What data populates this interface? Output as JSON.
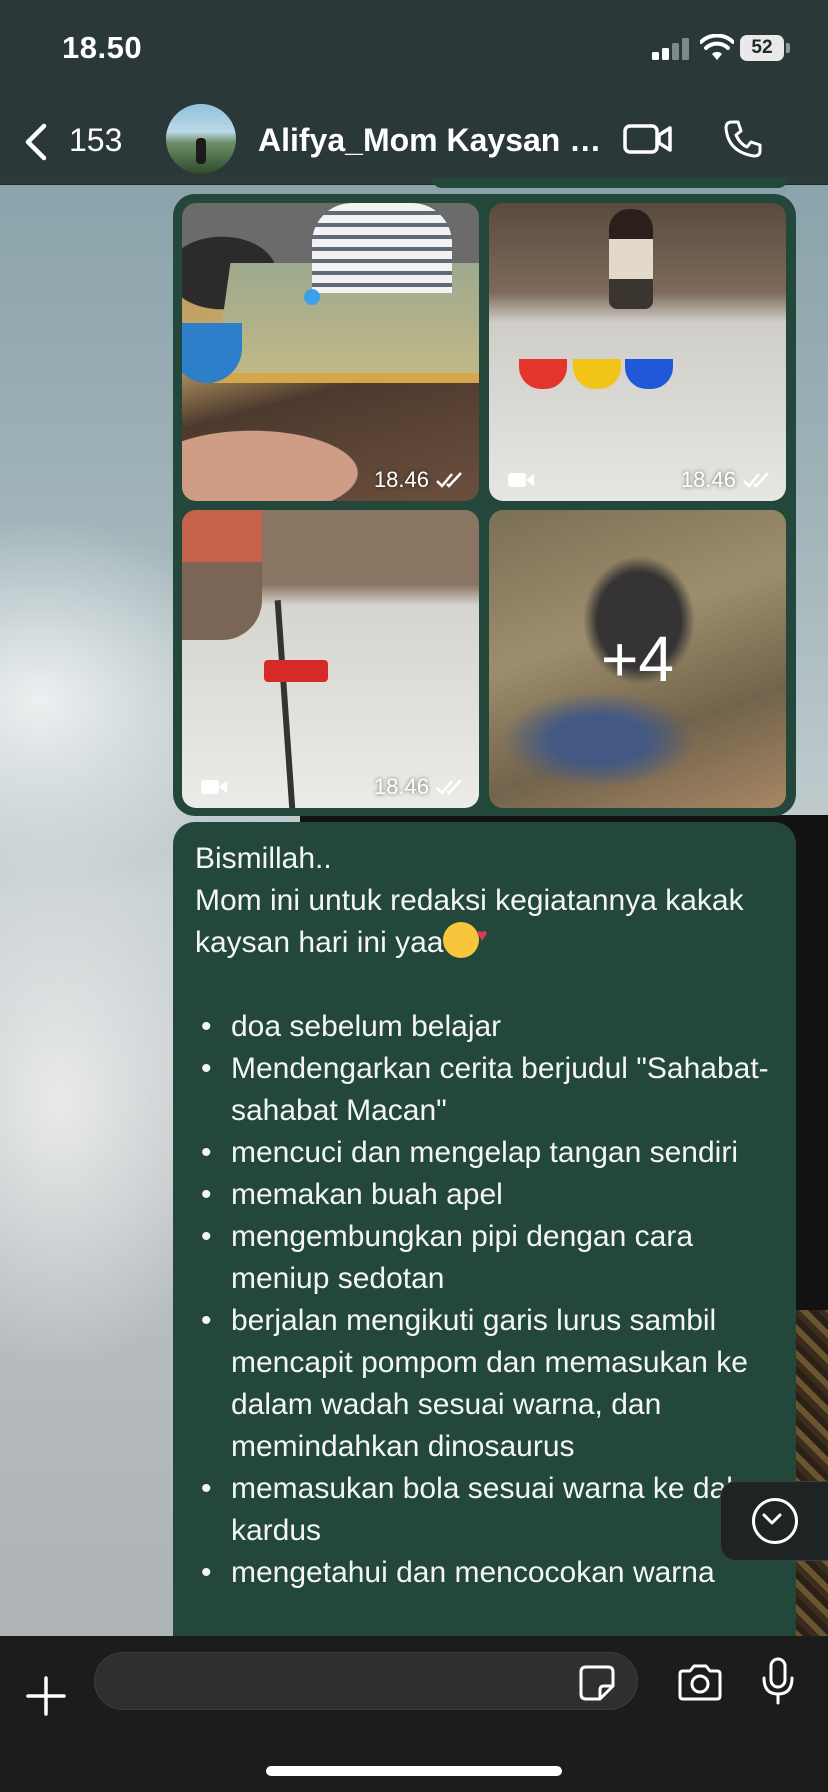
{
  "status_bar": {
    "time": "18.50",
    "battery": "52"
  },
  "header": {
    "back_count": "153",
    "title": "Alifya_Mom Kaysan (…"
  },
  "album": {
    "photos": [
      {
        "time": "18.46",
        "type": "photo"
      },
      {
        "time": "18.46",
        "type": "video"
      },
      {
        "time": "18.46",
        "type": "video"
      },
      {
        "more": "+4"
      }
    ]
  },
  "message": {
    "greeting": "Bismillah..",
    "intro": "Mom ini untuk redaksi kegiatannya kakak kaysan hari ini yaa",
    "intro_emoji": "smiling-face-with-hearts",
    "items": [
      "doa sebelum belajar",
      "Mendengarkan cerita berjudul \"Sahabat-sahabat Macan\"",
      "mencuci dan mengelap tangan sendiri",
      "memakan buah apel",
      "mengembungkan pipi dengan cara meniup sedotan",
      "berjalan mengikuti garis lurus sambil mencapit pompom dan memasukan ke dalam wadah sesuai warna, dan memindahkan dinosaurus",
      "memasukan bola sesuai warna ke dalam kardus",
      "mengetahui dan mencocokan warna"
    ]
  },
  "composer": {
    "input_value": "",
    "placeholder": ""
  },
  "colors": {
    "bubble": "#23473a",
    "header": "#263434",
    "composer": "#1c1c1c"
  }
}
